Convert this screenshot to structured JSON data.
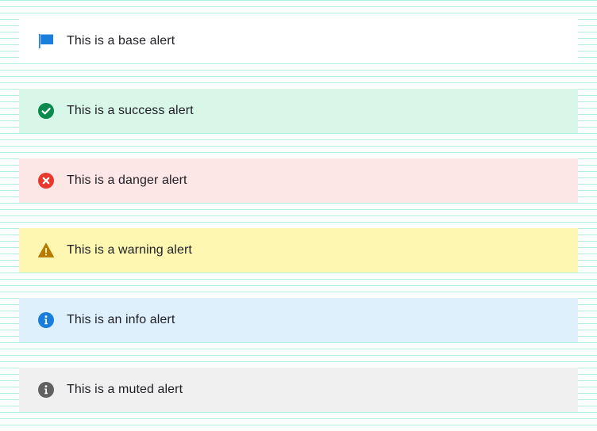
{
  "alerts": [
    {
      "variant": "base",
      "icon": "flag-icon",
      "icon_color": "#1a7fdc",
      "text": "This is a base alert"
    },
    {
      "variant": "success",
      "icon": "check-circle-icon",
      "icon_color": "#0b8a4e",
      "text": "This is a success alert"
    },
    {
      "variant": "danger",
      "icon": "x-circle-icon",
      "icon_color": "#e8392f",
      "text": "This is a danger alert"
    },
    {
      "variant": "warning",
      "icon": "warning-icon",
      "icon_color": "#b87a00",
      "text": "This is a warning alert"
    },
    {
      "variant": "info",
      "icon": "info-icon",
      "icon_color": "#1a7fdc",
      "text": "This is an info alert"
    },
    {
      "variant": "muted",
      "icon": "info-icon",
      "icon_color": "#616161",
      "text": "This is a muted alert"
    }
  ]
}
